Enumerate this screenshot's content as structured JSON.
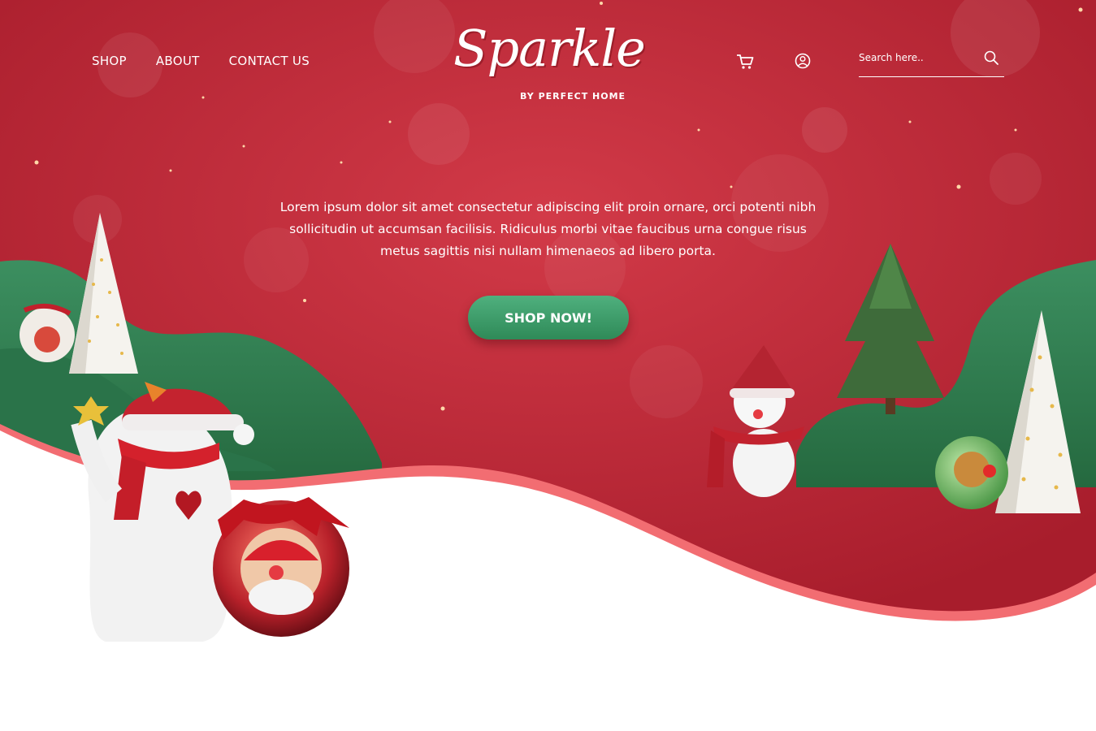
{
  "nav": {
    "links": [
      "SHOP",
      "ABOUT",
      "CONTACT US"
    ]
  },
  "logo": {
    "script": "Sparkle",
    "tagline": "BY PERFECT HOME"
  },
  "header_icons": {
    "cart": "cart-icon",
    "account": "user-circle-icon",
    "search": "search-icon"
  },
  "search": {
    "placeholder": "Search here.."
  },
  "hero": {
    "text": "Lorem ipsum dolor sit amet consectetur adipiscing elit proin ornare, orci potenti nibh sollicitudin ut accumsan facilisis. Ridiculus morbi vitae faucibus urna congue risus metus sagittis nisi nullam himenaeos ad libero porta.",
    "cta_label": "SHOP NOW!"
  },
  "colors": {
    "background_red": "#c4283a",
    "hill_green": "#2f7d52",
    "wave_pink": "#f26d72",
    "button_green": "#3d9d6b"
  }
}
